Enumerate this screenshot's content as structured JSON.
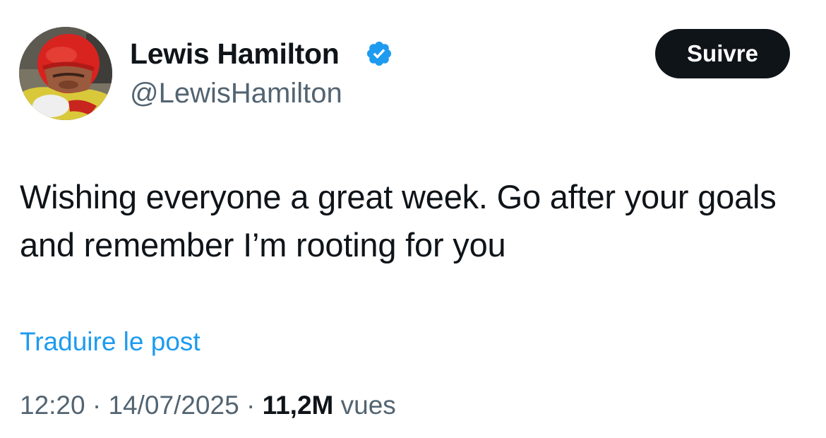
{
  "author": {
    "display_name": "Lewis Hamilton",
    "handle": "@LewisHamilton",
    "verified": true,
    "avatar_icon": "profile-photo-red-helmet"
  },
  "follow_button": {
    "label": "Suivre"
  },
  "tweet": {
    "text": "Wishing everyone a great week. Go after your goals and remember I’m rooting for you"
  },
  "translate": {
    "label": "Traduire le post"
  },
  "meta": {
    "time": "12:20",
    "separator": "·",
    "date": "14/07/2025",
    "views_count": "11,2M",
    "views_label": "vues"
  },
  "colors": {
    "text": "#0f1419",
    "secondary_text": "#536471",
    "link": "#1d9bf0",
    "verified_badge": "#1d9bf0",
    "button_bg": "#0f1419",
    "button_text": "#ffffff",
    "background": "#ffffff"
  }
}
